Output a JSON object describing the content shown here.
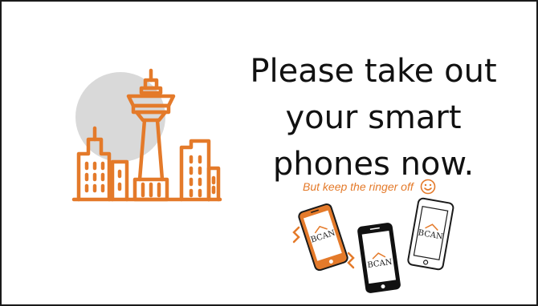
{
  "slide": {
    "headline_lines": [
      "Please take out",
      "your smart",
      "phones now."
    ],
    "subnote": "But keep the ringer off",
    "phone_logo_text": "BCAN"
  },
  "colors": {
    "accent": "#e47a2a",
    "circle": "#d9d9d9",
    "text": "#111111",
    "phone_black": "#111111"
  },
  "icons": [
    "city-skyline-icon",
    "smiley-icon",
    "vibrating-phone-icon",
    "phone-icon"
  ]
}
